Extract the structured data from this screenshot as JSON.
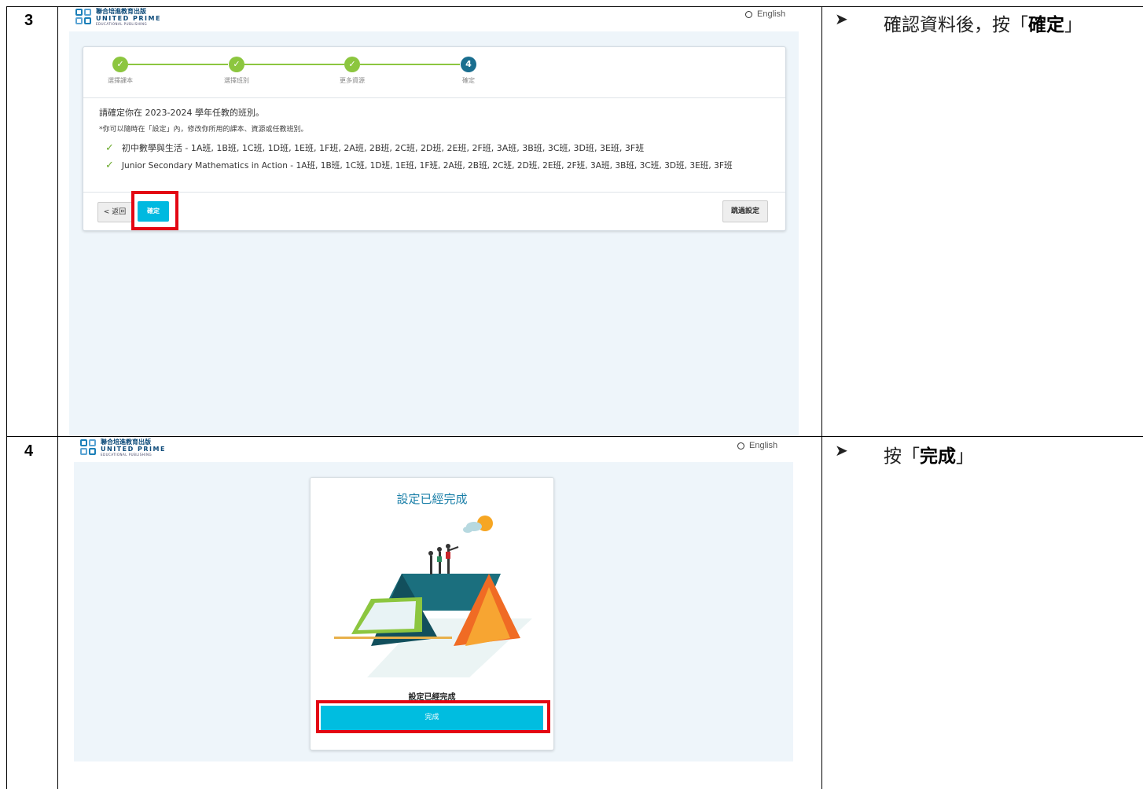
{
  "rows": [
    {
      "step": "3",
      "instruction": {
        "prefix": "確認資料後，按「",
        "bold": "確定",
        "suffix": "」"
      },
      "screen": {
        "logo": {
          "line1": "聯合培進教育出版",
          "line2": "UNITED PRIME",
          "line3": "EDUCATIONAL PUBLISHING"
        },
        "lang_label": "English",
        "steps": [
          {
            "label": "選擇課本",
            "icon": "check-icon",
            "done": true
          },
          {
            "label": "選擇班別",
            "icon": "check-icon",
            "done": true
          },
          {
            "label": "更多資源",
            "icon": "check-icon",
            "done": true
          },
          {
            "label": "確定",
            "number": "4",
            "done": false
          }
        ],
        "confirm_text": "請確定你在 2023-2024 學年任教的班別。",
        "note_text": "*你可以隨時在「設定」內，修改你所用的課本、資源或任教班別。",
        "selections": [
          "初中數學與生活 - 1A班, 1B班, 1C班, 1D班, 1E班, 1F班, 2A班, 2B班, 2C班, 2D班, 2E班, 2F班, 3A班, 3B班, 3C班, 3D班, 3E班, 3F班",
          "Junior Secondary Mathematics in Action - 1A班, 1B班, 1C班, 1D班, 1E班, 1F班, 2A班, 2B班, 2C班, 2D班, 2E班, 2F班, 3A班, 3B班, 3C班, 3D班, 3E班, 3F班"
        ],
        "back_label": "< 返回",
        "confirm_label": "確定",
        "skip_label": "跳過設定"
      }
    },
    {
      "step": "4",
      "instruction": {
        "prefix": "按「",
        "bold": "完成",
        "suffix": "」"
      },
      "screen": {
        "logo": {
          "line1": "聯合培進教育出版",
          "line2": "UNITED PRIME",
          "line3": "EDUCATIONAL PUBLISHING"
        },
        "lang_label": "English",
        "title": "設定已經完成",
        "caption": "設定已經完成",
        "done_label": "完成"
      }
    }
  ],
  "colors": {
    "accent": "#00b9e0",
    "step_done": "#8cc63f",
    "step_active": "#1a6e8f",
    "highlight": "#e30613",
    "title_blue": "#1a7fa8"
  }
}
